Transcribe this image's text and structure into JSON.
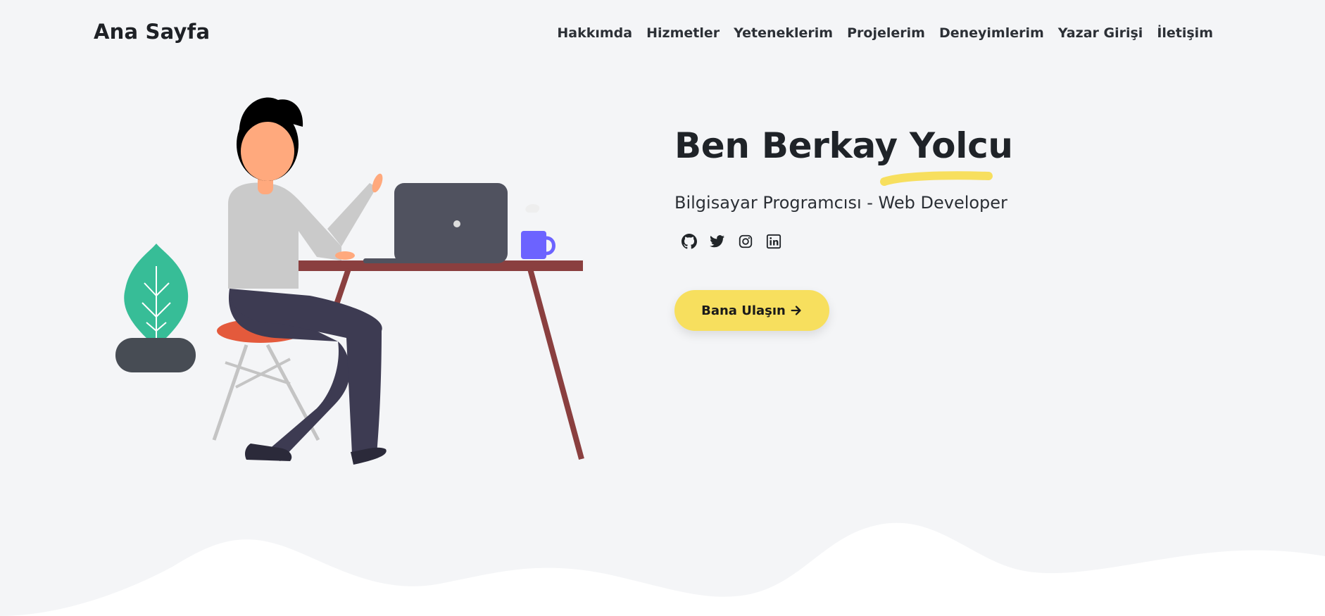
{
  "navbar": {
    "brand": "Ana Sayfa",
    "links": [
      {
        "label": "Hakkımda"
      },
      {
        "label": "Hizmetler"
      },
      {
        "label": "Yeteneklerim"
      },
      {
        "label": "Projelerim"
      },
      {
        "label": "Deneyimlerim"
      },
      {
        "label": "Yazar Girişi"
      },
      {
        "label": "İletişim"
      }
    ]
  },
  "hero": {
    "title": "Ben Berkay Yolcu",
    "subtitle": "Bilgisayar Programcısı - Web Developer",
    "social_icons": [
      "github-icon",
      "twitter-icon",
      "instagram-icon",
      "linkedin-icon"
    ],
    "cta_label": "Bana Ulaşın",
    "cta_icon": "arrow-right-icon"
  },
  "colors": {
    "background": "#f4f5f7",
    "accent_yellow": "#f7df5e",
    "wave": "#ffffff",
    "text_dark": "#1f2328"
  }
}
